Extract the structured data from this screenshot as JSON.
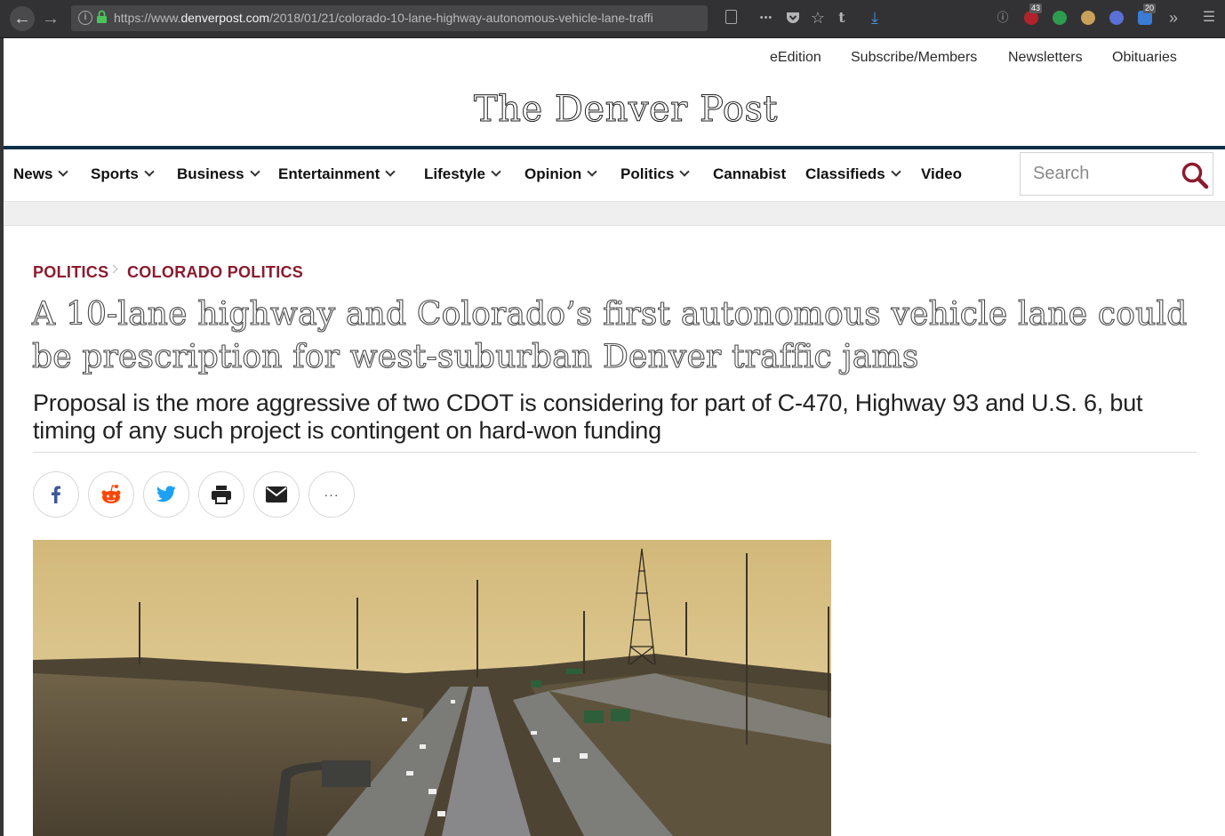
{
  "browser": {
    "url_prefix": "https://www.",
    "url_domain": "denverpost.com",
    "url_path": "/2018/01/21/colorado-10-lane-highway-autonomous-vehicle-lane-traffi",
    "badge_1": "43",
    "badge_2": "20",
    "tumblr_letter": "t",
    "more_dots": "•••"
  },
  "utility_nav": [
    "eEdition",
    "Subscribe/Members",
    "Newsletters",
    "Obituaries"
  ],
  "masthead": {
    "title": "The Denver Post"
  },
  "main_nav": {
    "items": [
      "News",
      "Sports",
      "Business",
      "Entertainment",
      "Lifestyle",
      "Opinion",
      "Politics",
      "Cannabist",
      "Classifieds",
      "Video"
    ],
    "search_placeholder": "Search"
  },
  "article": {
    "breadcrumb": [
      "POLITICS",
      "COLORADO POLITICS"
    ],
    "headline": "A 10-lane highway and Colorado’s first autonomous vehicle lane could be prescription for west-suburban Denver traffic jams",
    "dek": "Proposal is the more aggressive of two CDOT is considering for part of C-470, Highway 93 and U.S. 6, but timing of any such project is contingent on hard-won funding",
    "share_more": "···"
  },
  "colors": {
    "accent": "#8c1b2e",
    "nav_rule": "#0f2f48",
    "facebook": "#3b5998",
    "reddit": "#ff4500",
    "twitter": "#1da1f2"
  }
}
